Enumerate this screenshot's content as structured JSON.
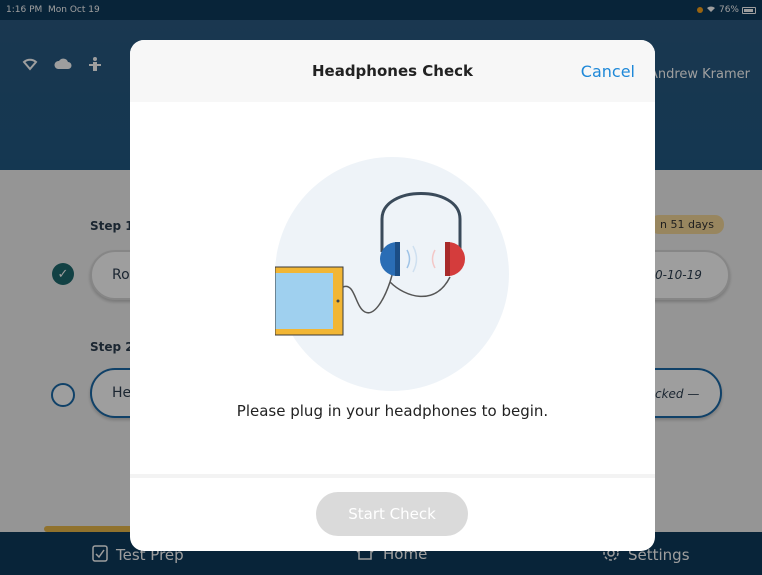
{
  "statusbar": {
    "time": "1:16 PM",
    "date": "Mon Oct 19",
    "battery": "76%"
  },
  "header": {
    "user_name": "Andrew Kramer"
  },
  "steps": [
    {
      "label": "Step 1",
      "pill_text": "Ro",
      "badge": "n 51 days",
      "right_text": "0-10-19",
      "completed": true
    },
    {
      "label": "Step 2",
      "pill_text": "He",
      "right_text": "cked —",
      "completed": false
    }
  ],
  "tabbar": {
    "tabs": [
      {
        "label": "Test Prep",
        "icon": "clipboard-check-icon"
      },
      {
        "label": "Home",
        "icon": "home-icon"
      },
      {
        "label": "Settings",
        "icon": "gear-icon"
      }
    ]
  },
  "modal": {
    "title": "Headphones Check",
    "cancel_label": "Cancel",
    "instruction": "Please plug in your headphones to begin.",
    "start_label": "Start Check"
  },
  "colors": {
    "primary": "#0e3a5c",
    "accent": "#1e88d8",
    "headphone_left": "#2a6db5",
    "headphone_right": "#d43c3c",
    "tablet_frame": "#f2b634",
    "tablet_screen": "#9fd0ef"
  }
}
